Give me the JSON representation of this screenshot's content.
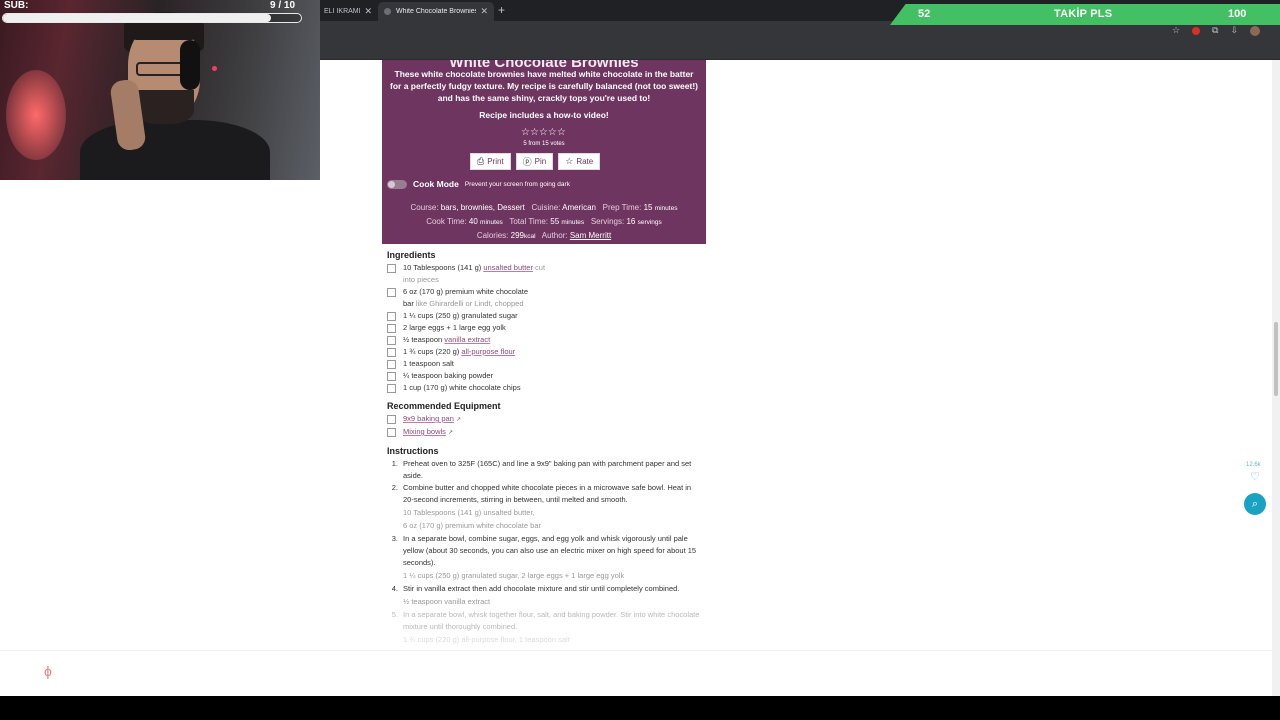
{
  "browser": {
    "tabs": [
      {
        "title": "ELİ İKRAMLIK"
      },
      {
        "title": "White Chocolate Brownies - Sa"
      }
    ],
    "new_tab": "+"
  },
  "overlay": {
    "sub_label": "SUB:",
    "sub_count": "9 / 10",
    "sub_progress": 0.9,
    "goal_current": "52",
    "goal_label": "TAKİP PLS",
    "goal_target": "100"
  },
  "recipe": {
    "title": "White Chocolate Brownies",
    "description": "These white chocolate brownies have melted white chocolate in the batter for a perfectly fudgy texture. My recipe is carefully balanced (not too sweet!) and has the same shiny, crackly tops you're used to!",
    "video_note_prefix": "Recipe includes a how-to",
    "video_note_link": "video!",
    "stars": "☆☆☆☆☆",
    "votes": "5 from 15 votes",
    "buttons": {
      "print": "Print",
      "pin": "Pin",
      "rate": "Rate"
    },
    "cook_mode": {
      "label": "Cook Mode",
      "desc": "Prevent your screen from going dark"
    },
    "meta": {
      "course_label": "Course:",
      "course": "bars, brownies, Dessert",
      "cuisine_label": "Cuisine:",
      "cuisine": "American",
      "prep_label": "Prep Time:",
      "prep": "15",
      "prep_unit": "minutes",
      "cook_label": "Cook Time:",
      "cook": "40",
      "cook_unit": "minutes",
      "total_label": "Total Time:",
      "total": "55",
      "total_unit": "minutes",
      "servings_label": "Servings:",
      "servings": "16",
      "servings_unit": "servings",
      "calories_label": "Calories:",
      "calories": "299",
      "calories_unit": "kcal",
      "author_label": "Author:",
      "author": "Sam Merritt"
    }
  },
  "ingredients": {
    "heading": "Ingredients",
    "items": [
      {
        "a": "10 Tablespoons (141 g) ",
        "link": "unsalted butter",
        "note": " cut into pieces"
      },
      {
        "a": "6 oz (170 g) premium white chocolate bar",
        "note": " like Ghirardelli or Lindt, chopped"
      },
      {
        "a": "1 ¼ cups (250 g) granulated sugar"
      },
      {
        "a": "2 large eggs + 1 large egg yolk"
      },
      {
        "a": "½ teaspoon ",
        "link": "vanilla extract"
      },
      {
        "a": "1 ¾ cups (220 g) ",
        "link": "all-purpose flour"
      },
      {
        "a": "1 teaspoon salt"
      },
      {
        "a": "¼ teaspoon baking powder"
      },
      {
        "a": "1 cup (170 g) white chocolate chips"
      }
    ]
  },
  "equipment": {
    "heading": "Recommended Equipment",
    "items": [
      {
        "link": "9x9 baking pan"
      },
      {
        "link": "Mixing bowls"
      }
    ]
  },
  "instructions": {
    "heading": "Instructions",
    "steps": [
      {
        "num": "1.",
        "text": "Preheat oven to 325F (165C) and line a 9x9\" baking pan with parchment paper and set aside."
      },
      {
        "num": "2.",
        "text": "Combine butter and chopped white chocolate pieces in a microwave safe bowl. Heat in 20-second increments, stirring in between, until melted and smooth.",
        "sub1": "10 Tablespoons (141 g) unsalted butter,",
        "sub2": "6 oz (170 g) premium white chocolate bar"
      },
      {
        "num": "3.",
        "text": "In a separate bowl, combine sugar, eggs, and egg yolk and whisk vigorously until pale yellow (about 30 seconds, you can also use an electric mixer on high speed for about 15 seconds).",
        "sub1": "1 ¼ cups (250 g) granulated sugar, 2 large eggs + 1 large egg yolk"
      },
      {
        "num": "4.",
        "text": "Stir in vanilla extract then add chocolate mixture and stir until completely combined.",
        "sub1": "½ teaspoon vanilla extract"
      },
      {
        "num": "5.",
        "text": "In a separate bowl, whisk together flour, salt, and baking powder. Stir into white chocolate mixture until thoroughly combined.",
        "sub1": "1 ¾ cups (220 g) all-purpose flour, 1 teaspoon salt"
      }
    ]
  },
  "widgets": {
    "fav_count": "12.6k"
  },
  "colors": {
    "recipe_card": "#6f3561",
    "goal_green": "#43c063",
    "search_button": "#1aa3c0"
  },
  "icons": {
    "print": "printer-icon",
    "pin": "pinterest-icon",
    "rate": "star-icon",
    "fav": "heart-icon",
    "search": "search-icon"
  }
}
